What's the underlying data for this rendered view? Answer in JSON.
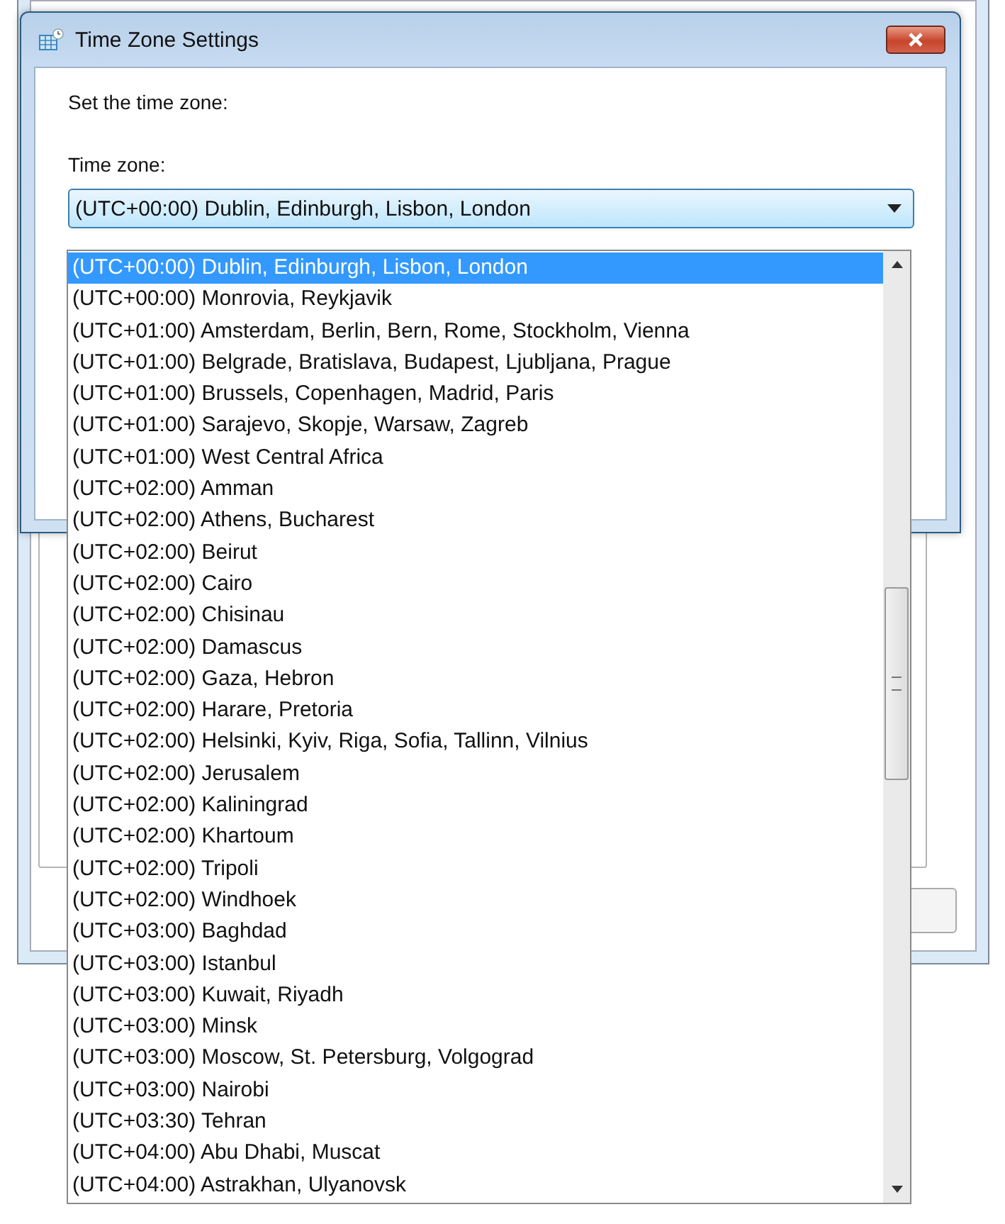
{
  "window": {
    "title": "Time Zone Settings"
  },
  "prompt": "Set the time zone:",
  "time_zone": {
    "label": "Time zone:",
    "value": "(UTC+00:00) Dublin, Edinburgh, Lisbon, London",
    "expanded": true
  },
  "options": [
    {
      "label": "(UTC+00:00) Dublin, Edinburgh, Lisbon, London",
      "selected": true
    },
    {
      "label": "(UTC+00:00) Monrovia, Reykjavik",
      "selected": false
    },
    {
      "label": "(UTC+01:00) Amsterdam, Berlin, Bern, Rome, Stockholm, Vienna",
      "selected": false
    },
    {
      "label": "(UTC+01:00) Belgrade, Bratislava, Budapest, Ljubljana, Prague",
      "selected": false
    },
    {
      "label": "(UTC+01:00) Brussels, Copenhagen, Madrid, Paris",
      "selected": false
    },
    {
      "label": "(UTC+01:00) Sarajevo, Skopje, Warsaw, Zagreb",
      "selected": false
    },
    {
      "label": "(UTC+01:00) West Central Africa",
      "selected": false
    },
    {
      "label": "(UTC+02:00) Amman",
      "selected": false
    },
    {
      "label": "(UTC+02:00) Athens, Bucharest",
      "selected": false
    },
    {
      "label": "(UTC+02:00) Beirut",
      "selected": false
    },
    {
      "label": "(UTC+02:00) Cairo",
      "selected": false
    },
    {
      "label": "(UTC+02:00) Chisinau",
      "selected": false
    },
    {
      "label": "(UTC+02:00) Damascus",
      "selected": false
    },
    {
      "label": "(UTC+02:00) Gaza, Hebron",
      "selected": false
    },
    {
      "label": "(UTC+02:00) Harare, Pretoria",
      "selected": false
    },
    {
      "label": "(UTC+02:00) Helsinki, Kyiv, Riga, Sofia, Tallinn, Vilnius",
      "selected": false
    },
    {
      "label": "(UTC+02:00) Jerusalem",
      "selected": false
    },
    {
      "label": "(UTC+02:00) Kaliningrad",
      "selected": false
    },
    {
      "label": "(UTC+02:00) Khartoum",
      "selected": false
    },
    {
      "label": "(UTC+02:00) Tripoli",
      "selected": false
    },
    {
      "label": "(UTC+02:00) Windhoek",
      "selected": false
    },
    {
      "label": "(UTC+03:00) Baghdad",
      "selected": false
    },
    {
      "label": "(UTC+03:00) Istanbul",
      "selected": false
    },
    {
      "label": "(UTC+03:00) Kuwait, Riyadh",
      "selected": false
    },
    {
      "label": "(UTC+03:00) Minsk",
      "selected": false
    },
    {
      "label": "(UTC+03:00) Moscow, St. Petersburg, Volgograd",
      "selected": false
    },
    {
      "label": "(UTC+03:00) Nairobi",
      "selected": false
    },
    {
      "label": "(UTC+03:30) Tehran",
      "selected": false
    },
    {
      "label": "(UTC+04:00) Abu Dhabi, Muscat",
      "selected": false
    },
    {
      "label": "(UTC+04:00) Astrakhan, Ulyanovsk",
      "selected": false
    }
  ]
}
